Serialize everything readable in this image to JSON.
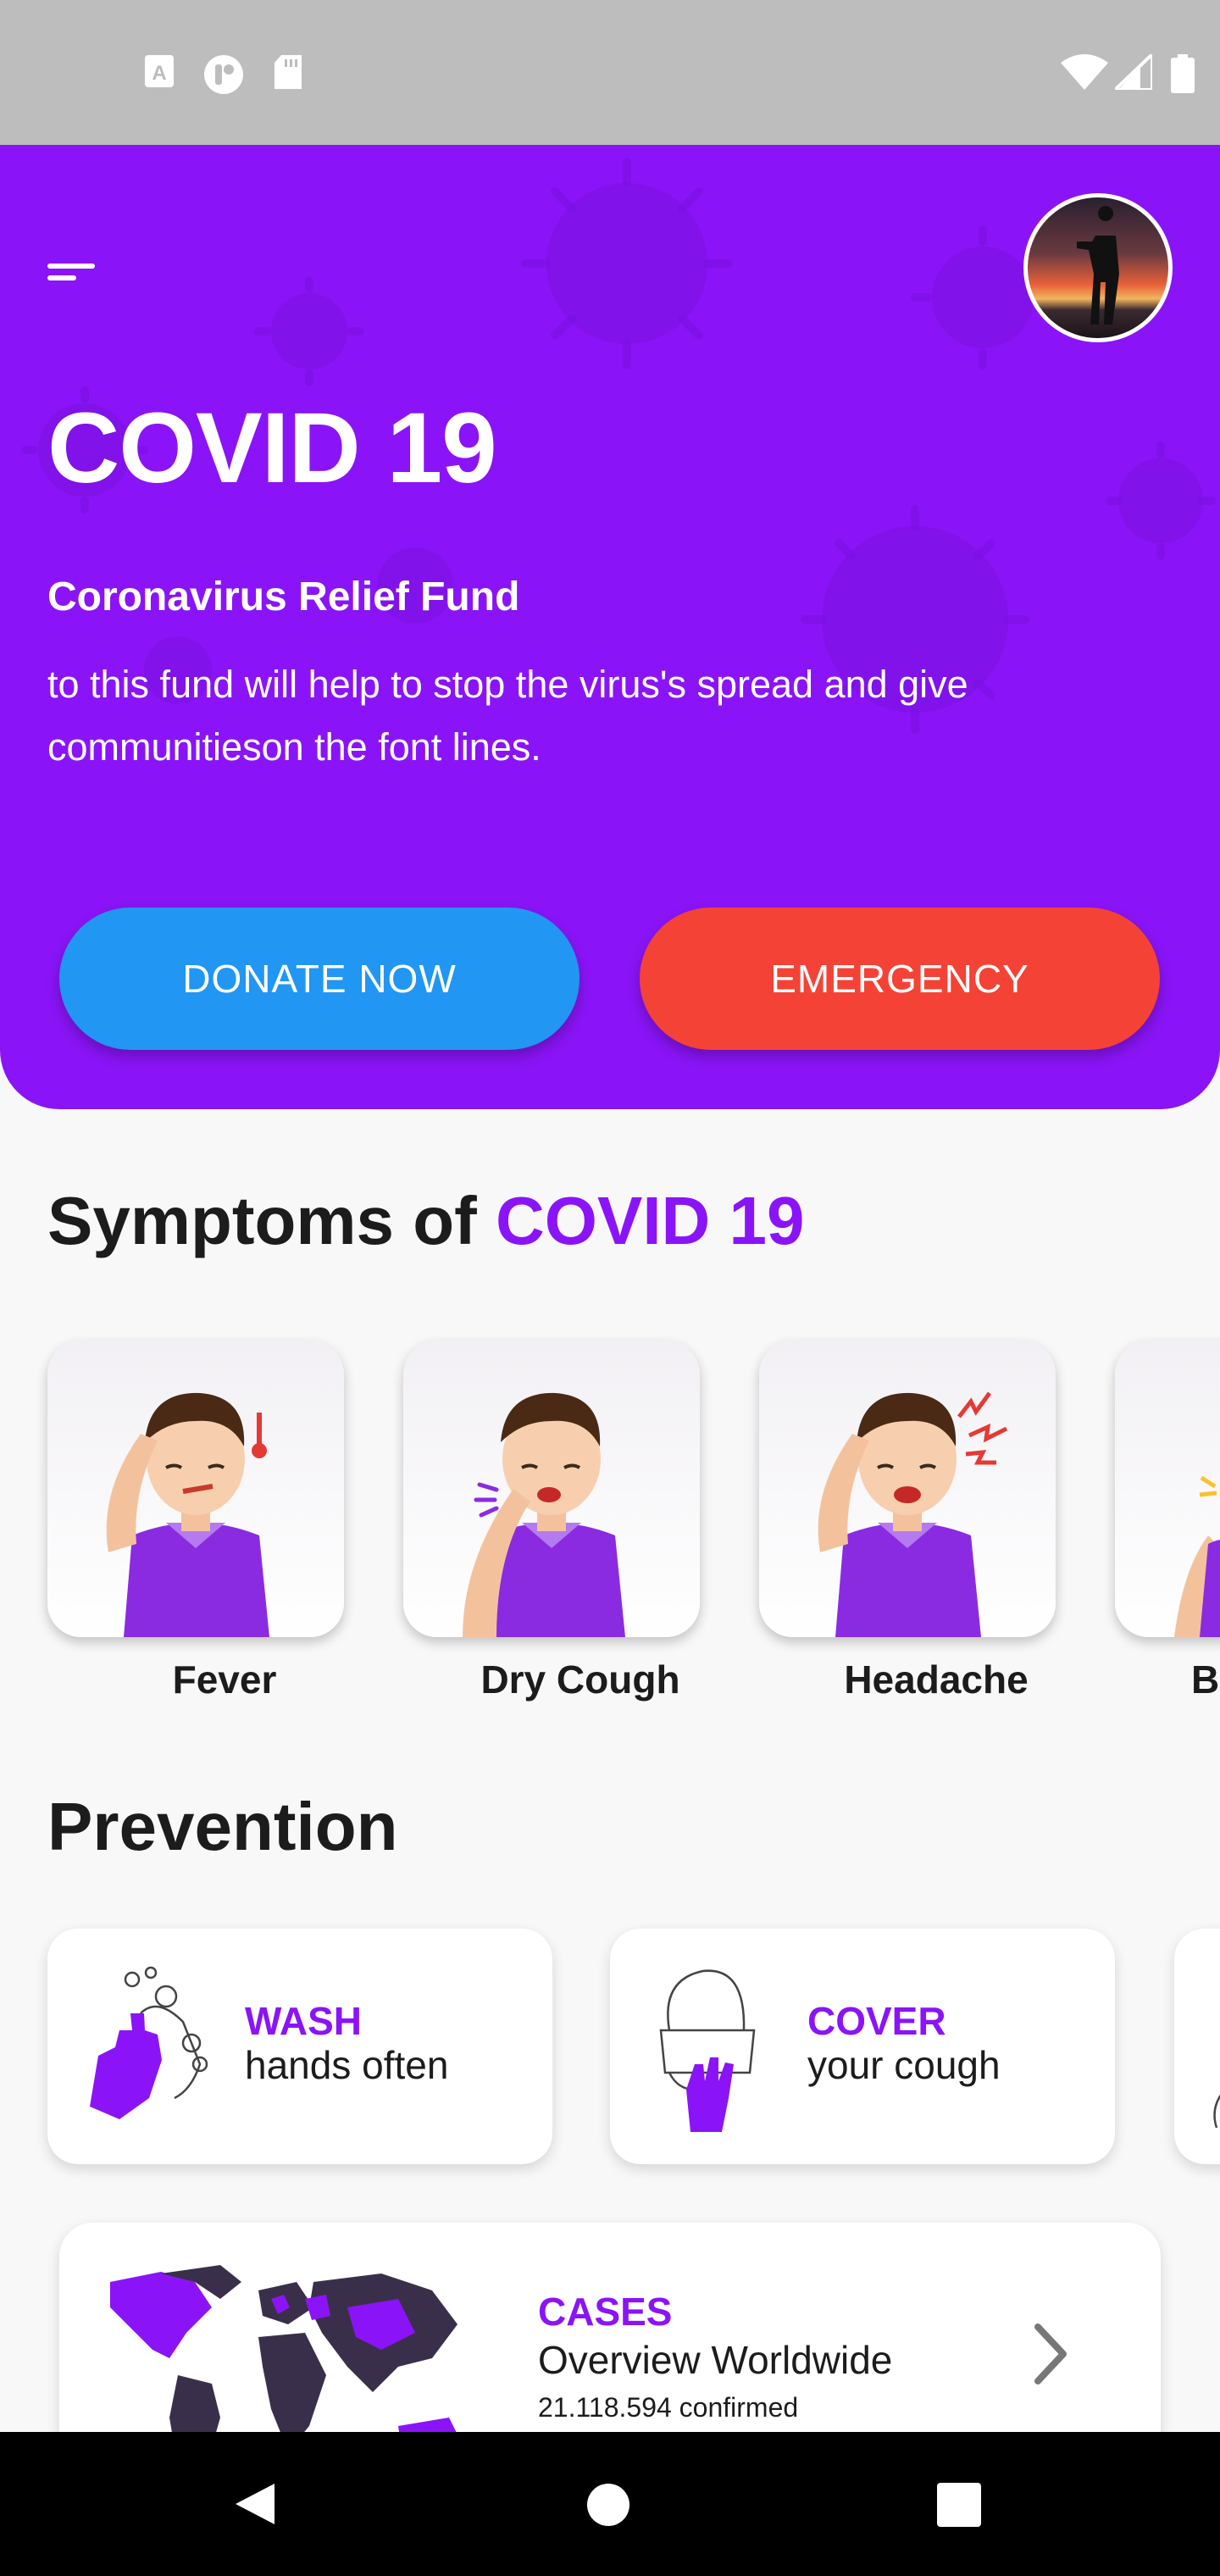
{
  "hero": {
    "title": "COVID 19",
    "subtitle": "Coronavirus Relief Fund",
    "description": "to this fund will help to stop the virus's spread and give communitieson the font lines.",
    "donate_label": "DONATE NOW",
    "emergency_label": "EMERGENCY"
  },
  "symptoms": {
    "title_prefix": "Symptoms of ",
    "title_accent": "COVID 19",
    "items": [
      {
        "label": "Fever"
      },
      {
        "label": "Dry Cough"
      },
      {
        "label": "Headache"
      },
      {
        "label": "B"
      }
    ]
  },
  "prevention": {
    "title": "Prevention",
    "items": [
      {
        "title": "WASH",
        "subtitle": "hands often"
      },
      {
        "title": "COVER",
        "subtitle": "your cough"
      }
    ]
  },
  "cases": {
    "title": "CASES",
    "subtitle": "Overview Worldwide",
    "count": "21.118.594 confirmed"
  },
  "colors": {
    "primary": "#8a14f7",
    "donate": "#2196f3",
    "emergency": "#f44336"
  }
}
